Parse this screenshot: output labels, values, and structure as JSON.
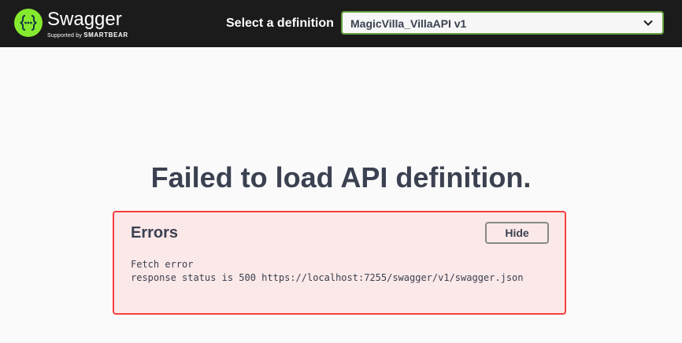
{
  "topbar": {
    "brand_name": "Swagger",
    "brand_tagline_prefix": "Supported by",
    "brand_tagline_company": "SMARTBEAR",
    "select_label": "Select a definition",
    "selected_definition": "MagicVilla_VillaAPI v1"
  },
  "main": {
    "title": "Failed to load API definition.",
    "errors": {
      "heading": "Errors",
      "hide_label": "Hide",
      "items": [
        {
          "title": "Fetch error",
          "message": "response status is 500 https://localhost:7255/swagger/v1/swagger.json"
        }
      ]
    }
  },
  "colors": {
    "topbar_bg": "#1b1b1b",
    "accent_green": "#62a03f",
    "logo_green": "#85ea2d",
    "error_border": "#f93e3e",
    "error_bg": "#fbe8e8",
    "text": "#3b4151"
  },
  "icons": {
    "logo": "swagger-logo-icon",
    "select_arrow": "chevron-down-icon"
  }
}
